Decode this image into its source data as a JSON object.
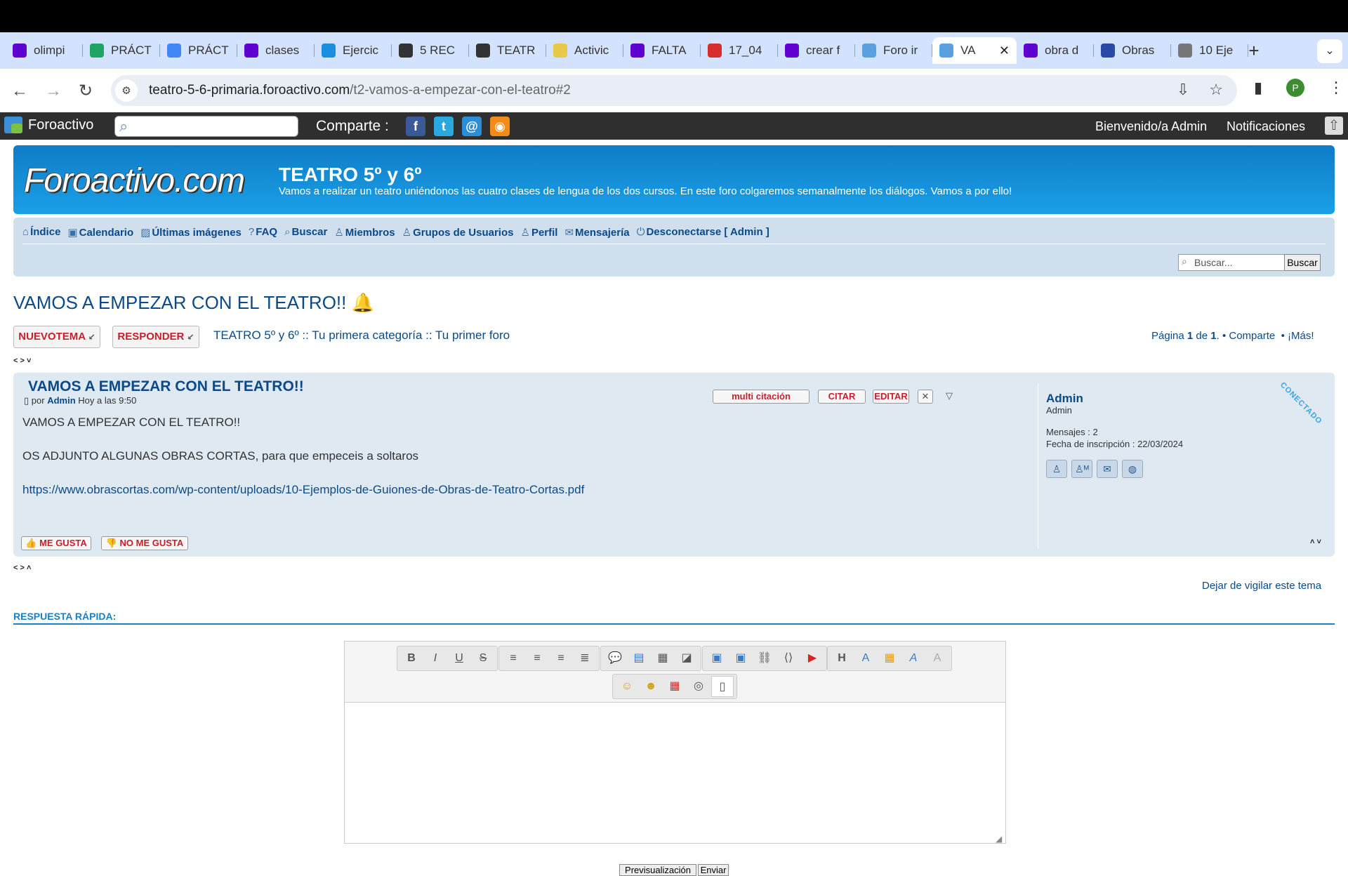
{
  "browser": {
    "tabs": [
      {
        "label": "olimpi",
        "icon": "yahoo-icon",
        "color": "#6001d2"
      },
      {
        "label": "PRÁCT",
        "icon": "google-drive-icon",
        "color": "#1fa463"
      },
      {
        "label": "PRÁCT",
        "icon": "google-docs-icon",
        "color": "#4285f4"
      },
      {
        "label": "clases",
        "icon": "yahoo-icon",
        "color": "#6001d2"
      },
      {
        "label": "Ejercic",
        "icon": "wn-icon",
        "color": "#1a8fe0"
      },
      {
        "label": "5 REC",
        "icon": "film-icon",
        "color": "#333333"
      },
      {
        "label": "TEATR",
        "icon": "film-icon",
        "color": "#333333"
      },
      {
        "label": "Activic",
        "icon": "document-icon",
        "color": "#e8c94a"
      },
      {
        "label": "FALTA",
        "icon": "yahoo-icon",
        "color": "#6001d2"
      },
      {
        "label": "17_04",
        "icon": "red-glyph-icon",
        "color": "#d92c2c"
      },
      {
        "label": "crear f",
        "icon": "yahoo-icon",
        "color": "#6001d2"
      },
      {
        "label": "Foro ir",
        "icon": "chat-bubbles-icon",
        "color": "#5aa0e0"
      },
      {
        "label": "VA",
        "icon": "chat-bubbles-icon",
        "color": "#5aa0e0",
        "active": true
      },
      {
        "label": "obra d",
        "icon": "yahoo-icon",
        "color": "#6001d2"
      },
      {
        "label": "Obras",
        "icon": "globe-icon",
        "color": "#2b4aa8"
      },
      {
        "label": "10 Eje",
        "icon": "mask-icon",
        "color": "#777777"
      }
    ],
    "new_tab": "+",
    "tab_menu": "⌄",
    "url_host": "teatro-5-6-primaria.foroactivo.com",
    "url_path": "/t2-vamos-a-empezar-con-el-teatro#2",
    "profile_initial": "P"
  },
  "fa_toolbar": {
    "brand": "Foroactivo",
    "share_label": "Comparte :",
    "social": [
      {
        "name": "facebook-icon",
        "glyph": "f",
        "color": "#3b5998"
      },
      {
        "name": "twitter-icon",
        "glyph": "t",
        "color": "#2aa9e0"
      },
      {
        "name": "email-icon",
        "glyph": "@",
        "color": "#2a8fd6"
      },
      {
        "name": "rss-icon",
        "glyph": "◉",
        "color": "#f28b1a"
      }
    ],
    "welcome": "Bienvenido/a Admin",
    "notifications": "Notificaciones"
  },
  "header": {
    "logo_text": "Foroactivo.com",
    "title": "TEATRO 5º y 6º",
    "description": "Vamos a realizar un teatro uniéndonos las cuatro clases de lengua de los dos cursos. En este foro colgaremos semanalmente los diálogos. Vamos a por ello!"
  },
  "nav": {
    "items": [
      {
        "label": "Índice",
        "icon": "⌂"
      },
      {
        "label": "Calendario",
        "icon": "▣"
      },
      {
        "label": "Últimas imágenes",
        "icon": "▨"
      },
      {
        "label": "FAQ",
        "icon": "?"
      },
      {
        "label": "Buscar",
        "icon": "⌕"
      },
      {
        "label": "Miembros",
        "icon": "♙"
      },
      {
        "label": "Grupos de Usuarios",
        "icon": "♙"
      },
      {
        "label": "Perfil",
        "icon": "♙"
      },
      {
        "label": "Mensajería",
        "icon": "✉"
      },
      {
        "label": "Desconectarse [ Admin ]",
        "icon": "⏻"
      }
    ],
    "search_placeholder": "Buscar...",
    "search_button": "Buscar"
  },
  "topic": {
    "title": "VAMOS A EMPEZAR CON EL TEATRO!!",
    "new_topic_btn": "NUEVOTEMA",
    "reply_btn": "RESPONDER",
    "breadcrumb": "TEATRO 5º y 6º :: Tu primera categoría :: Tu primer foro",
    "page_label": "Página",
    "page_num": "1",
    "page_of": "de",
    "page_total": "1",
    "share": "• Comparte",
    "more": "• ¡Más!"
  },
  "post": {
    "title": "VAMOS A EMPEZAR CON EL TEATRO!!",
    "by": "por",
    "author": "Admin",
    "time": "Hoy a las 9:50",
    "lines": [
      "VAMOS A EMPEZAR CON EL TEATRO!!",
      "OS ADJUNTO ALGUNAS OBRAS CORTAS, para que empeceis a soltaros"
    ],
    "link": "https://www.obrascortas.com/wp-content/uploads/10-Ejemplos-de-Guiones-de-Obras-de-Teatro-Cortas.pdf",
    "buttons": {
      "multi": "multi citación",
      "quote": "CITAR",
      "edit": "EDITAR"
    },
    "like": "ME GUSTA",
    "dislike": "NO ME GUSTA",
    "status_ribbon": "CONECTADO",
    "author_panel": {
      "name": "Admin",
      "rank": "Admin",
      "messages": "Mensajes : 2",
      "joined": "Fecha de inscripción : 22/03/2024"
    }
  },
  "unwatch": "Dejar de vigilar este tema",
  "quick_reply": {
    "title": "RESPUESTA RÁPIDA:",
    "preview": "Previsualización",
    "send": "Enviar"
  }
}
